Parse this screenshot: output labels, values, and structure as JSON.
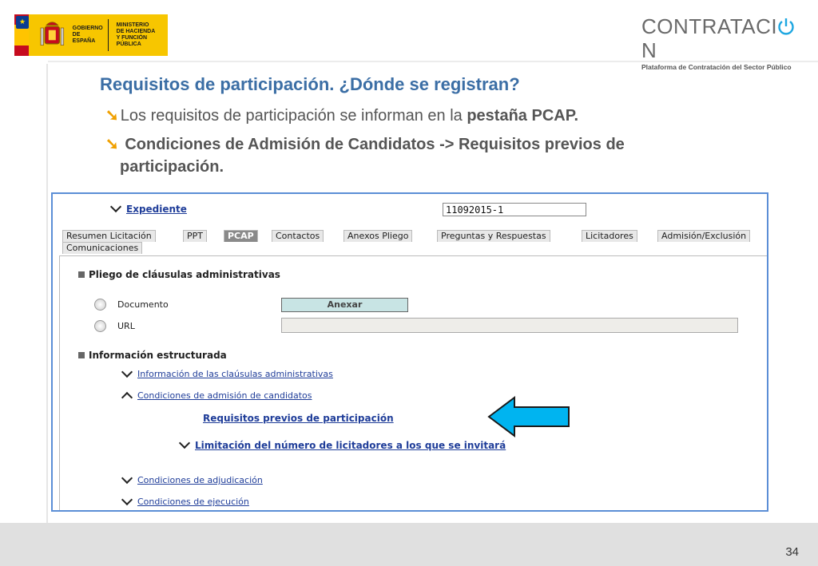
{
  "header": {
    "gov_logo": {
      "line1": "GOBIERNO\nDE ESPAÑA",
      "line2": "MINISTERIO\nDE HACIENDA\nY FUNCIÓN PÚBLICA"
    },
    "brand": {
      "title_start": "CONTRATACI",
      "title_icon": "power-icon",
      "title_end": "N",
      "subtitle": "Plataforma de Contratación del Sector Público"
    }
  },
  "slide": {
    "title": "Requisitos de participación. ¿Dónde se registran?",
    "bullet1_text": "Los requisitos de participación se  informan en la ",
    "bullet1_bold": "pestaña PCAP.",
    "bullet2_line1": " Condiciones de Admisión de Candidatos -> Requisitos previos de",
    "bullet2_line2": "participación.",
    "page_number": "34"
  },
  "screen": {
    "expediente_label": "Expediente",
    "expediente_value": "11092015-1",
    "tabs": [
      {
        "label": "Resumen Licitación"
      },
      {
        "label": "PPT"
      },
      {
        "label": "PCAP"
      },
      {
        "label": "Contactos"
      },
      {
        "label": "Anexos Pliego"
      },
      {
        "label": "Preguntas y Respuestas"
      },
      {
        "label": "Licitadores"
      },
      {
        "label": "Admisión/Exclusión"
      },
      {
        "label": "Comunicaciones"
      }
    ],
    "active_tab": "PCAP",
    "section1_title": "Pliego de cláusulas administrativas",
    "radio_documento": "Documento",
    "radio_url": "URL",
    "anexar_label": "Anexar",
    "section2_title": "Información estructurada",
    "links": {
      "info_clausulas": "Información de las claúsulas administrativas",
      "cond_admision": "Condiciones de admisión de candidatos",
      "requisitos_previos": "Requisitos previos de participación",
      "limitacion": "Limitación del número de licitadores a los que se invitará",
      "cond_adjudicacion": "Condiciones de adjudicación",
      "cond_ejecucion": "Condiciones de ejecución"
    }
  },
  "colors": {
    "title_blue": "#3b6ea5",
    "link_blue": "#1f3d99",
    "arrow_cyan": "#00b4f0",
    "bullet_orange": "#f0a000"
  }
}
